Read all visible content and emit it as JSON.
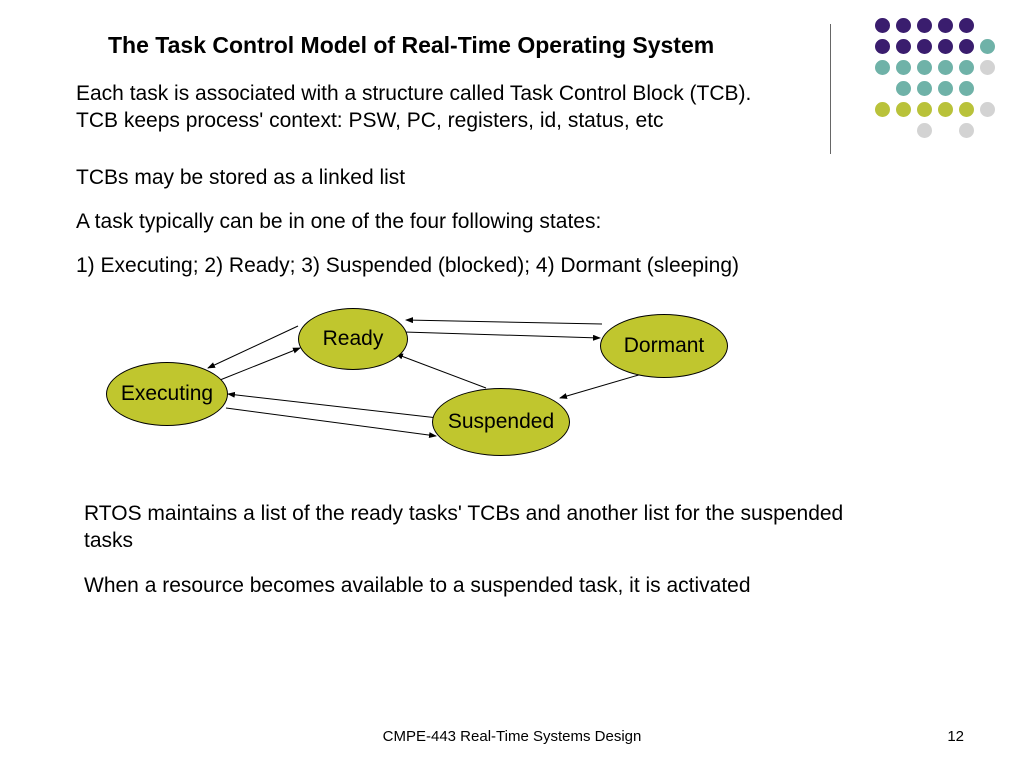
{
  "title": "The Task Control Model of Real-Time Operating System",
  "paragraphs": {
    "p1": "Each task is associated with a structure called Task Control Block (TCB). TCB keeps process' context: PSW, PC, registers, id, status, etc",
    "p2": "TCBs may be stored as a linked list",
    "p3": "A task typically can be in one of the four following states:",
    "p4": "1) Executing; 2) Ready; 3) Suspended (blocked); 4) Dormant (sleeping)",
    "p5": "RTOS maintains a list of the ready tasks' TCBs and another list for the suspended tasks",
    "p6": "When a resource becomes available to a suspended task, it is activated"
  },
  "nodes": {
    "executing": "Executing",
    "ready": "Ready",
    "suspended": "Suspended",
    "dormant": "Dormant"
  },
  "footer": {
    "course": "CMPE-443 Real-Time Systems Design",
    "page": "12"
  },
  "dot_pattern": [
    [
      "c1",
      "c1",
      "c1",
      "c1",
      "c1",
      "c0"
    ],
    [
      "c1",
      "c1",
      "c1",
      "c1",
      "c1",
      "c2"
    ],
    [
      "c2",
      "c2",
      "c2",
      "c2",
      "c2",
      "c4"
    ],
    [
      "c0",
      "c2",
      "c2",
      "c2",
      "c2",
      "c0"
    ],
    [
      "c3",
      "c3",
      "c3",
      "c3",
      "c3",
      "c4"
    ],
    [
      "c0",
      "c0",
      "c4",
      "c0",
      "c4",
      "c0"
    ]
  ]
}
